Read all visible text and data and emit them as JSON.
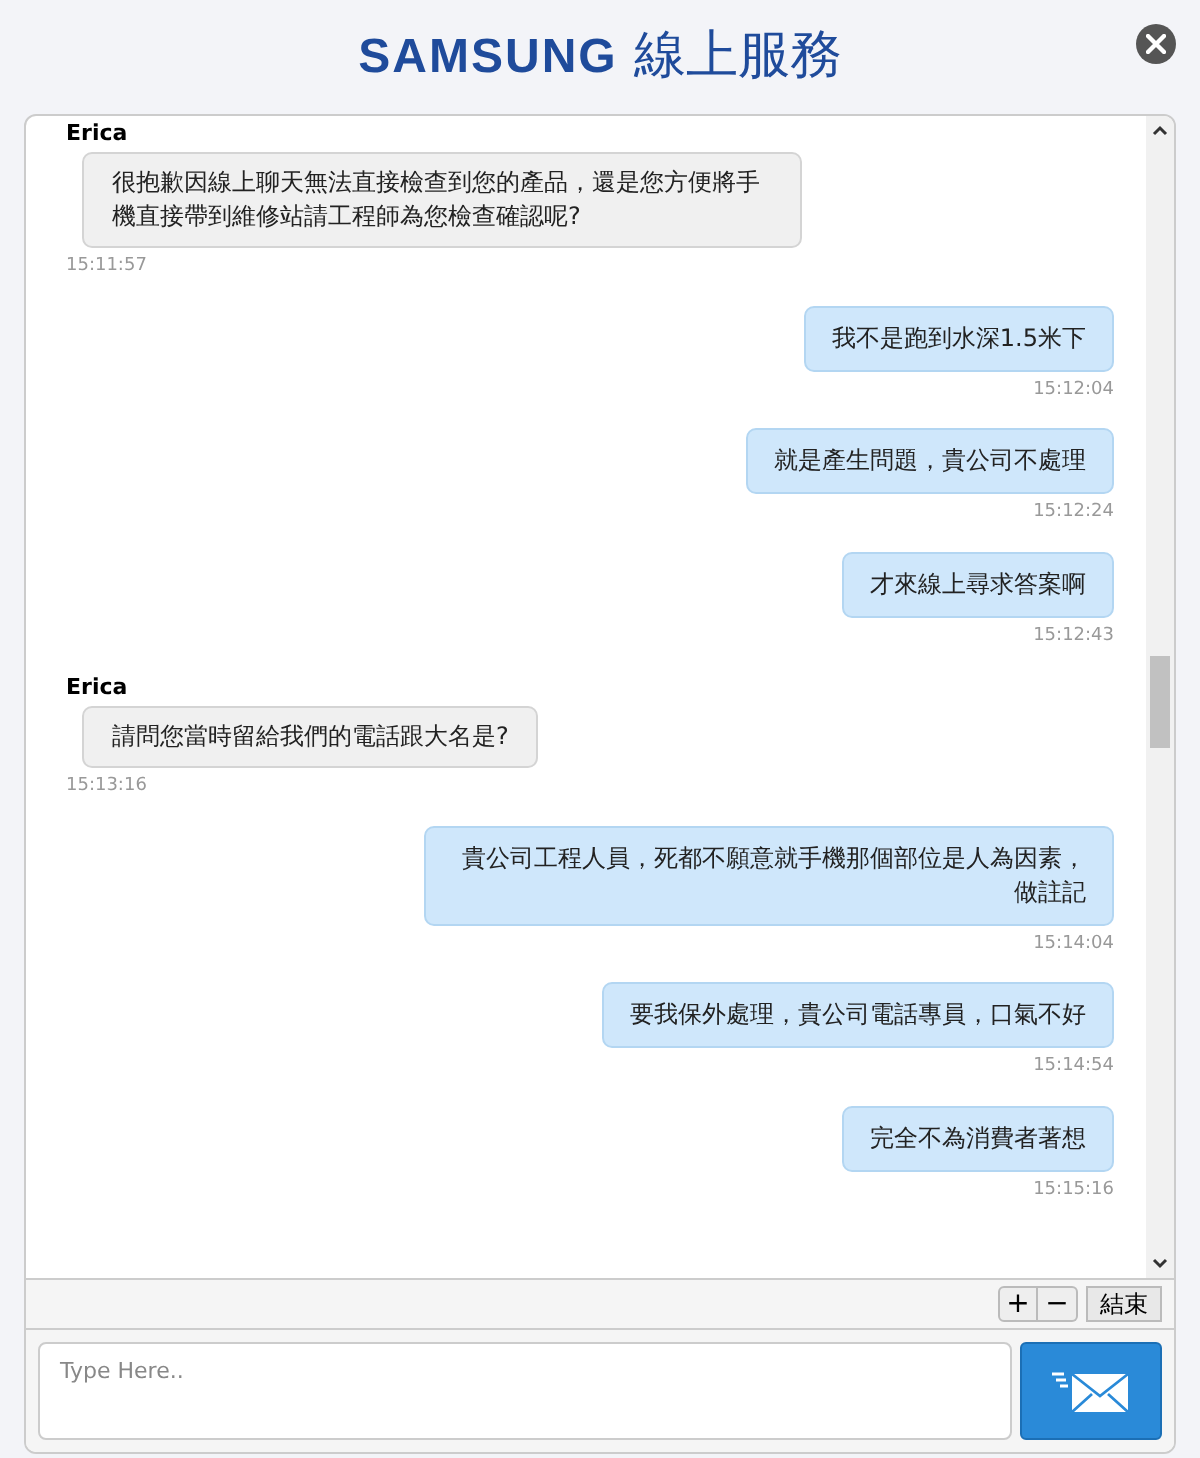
{
  "header": {
    "brand": "SAMSUNG",
    "service": "線上服務"
  },
  "messages": [
    {
      "kind": "agent",
      "sender": "Erica",
      "text": "很抱歉因線上聊天無法直接檢查到您的產品，還是您方便將手機直接帶到維修站請工程師為您檢查確認呢?",
      "time": "15:11:57"
    },
    {
      "kind": "user",
      "text": "我不是跑到水深1.5米下",
      "time": "15:12:04"
    },
    {
      "kind": "user",
      "text": "就是產生問題，貴公司不處理",
      "time": "15:12:24"
    },
    {
      "kind": "user",
      "text": "才來線上尋求答案啊",
      "time": "15:12:43"
    },
    {
      "kind": "agent",
      "sender": "Erica",
      "text": "請問您當時留給我們的電話跟大名是?",
      "time": "15:13:16"
    },
    {
      "kind": "user",
      "text": "貴公司工程人員，死都不願意就手機那個部位是人為因素，做註記",
      "time": "15:14:04"
    },
    {
      "kind": "user",
      "text": "要我保外處理，貴公司電話專員，口氣不好",
      "time": "15:14:54"
    },
    {
      "kind": "user",
      "text": "完全不為消費者著想",
      "time": "15:15:16"
    }
  ],
  "toolbar": {
    "zoom_in": "+",
    "zoom_out": "−",
    "end": "結束"
  },
  "composer": {
    "placeholder": "Type Here.."
  }
}
